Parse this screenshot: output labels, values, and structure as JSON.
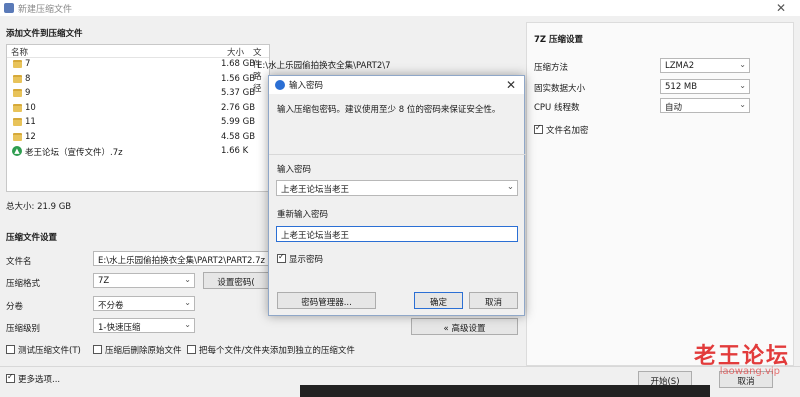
{
  "window": {
    "title": "新建压缩文件",
    "close_glyph": "✕"
  },
  "files_section": {
    "title": "添加文件到压缩文件",
    "columns": {
      "name": "名称",
      "size": "大小",
      "path": "文件路径"
    },
    "rows": [
      {
        "name": "7",
        "size": "1.68 GB",
        "path": "E:\\水上乐园偷拍换衣全集\\PART2\\7"
      },
      {
        "name": "8",
        "size": "1.56 GB",
        "path": ""
      },
      {
        "name": "9",
        "size": "5.37 GB",
        "path": ""
      },
      {
        "name": "10",
        "size": "2.76 GB",
        "path": ""
      },
      {
        "name": "11",
        "size": "5.99 GB",
        "path": ""
      },
      {
        "name": "12",
        "size": "4.58 GB",
        "path": ""
      },
      {
        "name": "老王论坛（宣传文件）.7z",
        "size": "1.66 K",
        "path": ""
      }
    ],
    "total": "总大小: 21.9 GB"
  },
  "archive_settings": {
    "title": "压缩文件设置",
    "file_name_label": "文件名",
    "file_name_value": "E:\\水上乐园偷拍换衣全集\\PART2\\PART2.7z",
    "format_label": "压缩格式",
    "format_value": "7Z",
    "set_password_label": "设置密码(",
    "split_label": "分卷",
    "split_value": "不分卷",
    "level_label": "压缩级别",
    "level_value": "1-快速压缩",
    "advanced_label": "« 高级设置",
    "test_label": "测试压缩文件(T)",
    "delete_label": "压缩后删除原始文件",
    "separate_label": "把每个文件/文件夹添加到独立的压缩文件",
    "more_options_label": "更多选项..."
  },
  "sevenz_settings": {
    "title": "7Z 压缩设置",
    "method_label": "压缩方法",
    "method_value": "LZMA2",
    "block_label": "固实数据大小",
    "block_value": "512 MB",
    "threads_label": "CPU 线程数",
    "threads_value": "自动",
    "encrypt_names_label": "文件名加密"
  },
  "footer": {
    "start_label": "开始(S)",
    "cancel_label": "取消"
  },
  "password_dialog": {
    "title": "输入密码",
    "hint": "输入压缩包密码。建议使用至少 8 位的密码来保证安全性。",
    "password_label": "输入密码",
    "password_value": "上老王论坛当老王",
    "confirm_label": "重新输入密码",
    "confirm_value": "上老王论坛当老王",
    "show_password_label": "显示密码",
    "manager_label": "密码管理器...",
    "ok_label": "确定",
    "cancel_label": "取消"
  },
  "watermark": {
    "text": "老王论坛",
    "url": "laowang.vip"
  },
  "colors": {
    "accent": "#2b6fd4",
    "folder": "#e8c35a",
    "watermark": "#e23b3b"
  }
}
